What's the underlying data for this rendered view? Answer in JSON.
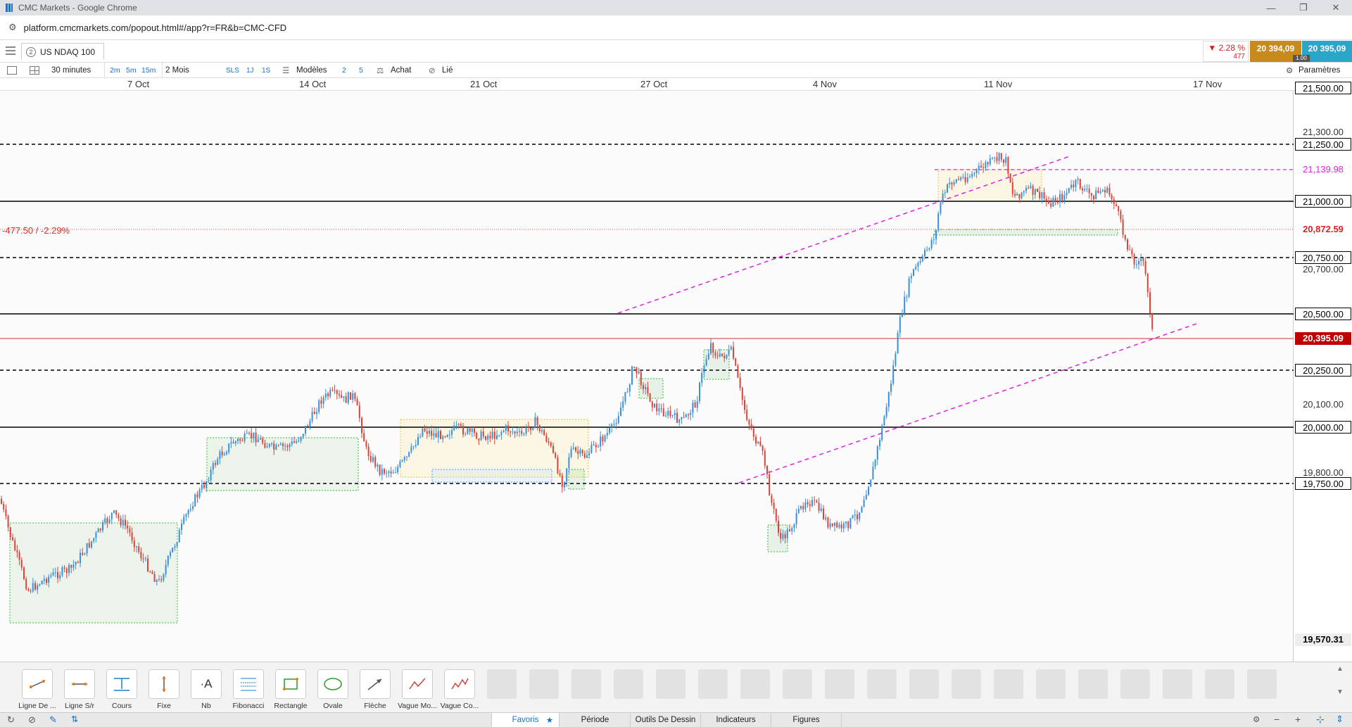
{
  "window": {
    "title": "CMC Markets - Google Chrome"
  },
  "browser": {
    "url": "platform.cmcmarkets.com/popout.html#/app?r=FR&b=CMC-CFD"
  },
  "instrument": {
    "badge": "2",
    "name": "US NDAQ 100"
  },
  "quote": {
    "change_pct": "▼ 2.28 %",
    "change_pts": "477",
    "sell": "20 394,09",
    "buy": "20 395,09",
    "spread": "1.00"
  },
  "toolbar": {
    "interval": "30 minutes",
    "quick_intervals": [
      "2m",
      "5m",
      "15m"
    ],
    "range": "2 Mois",
    "quick_ranges": [
      "SLS",
      "1J",
      "1S"
    ],
    "templates": "Modèles",
    "num_a": "2",
    "num_b": "5",
    "side": "Achat",
    "linked": "Lié",
    "settings": "Paramètres"
  },
  "date_axis": [
    "7 Oct",
    "14 Oct",
    "21 Oct",
    "27 Oct",
    "4 Nov",
    "11 Nov",
    "17 Nov"
  ],
  "price_axis": {
    "levels": [
      "21,500.00",
      "21,300.00",
      "21,250.00",
      "21,139.98",
      "21,000.00",
      "20,872.59",
      "20,750.00",
      "20,700.00",
      "20,500.00",
      "20,395.09",
      "20,250.00",
      "20,100.00",
      "20,000.00",
      "19,800.00",
      "19,750.00",
      "19,570.31"
    ]
  },
  "chart_annotation": "-477.50 / -2.29%",
  "drawing_tools": [
    "Ligne De ...",
    "Ligne S/r",
    "Cours",
    "Fixe",
    "Nb",
    "Fibonacci",
    "Rectangle",
    "Ovale",
    "Flèche",
    "Vague Mo...",
    "Vague Co..."
  ],
  "bottom_tabs": [
    "Favoris",
    "Période",
    "Outils De Dessin",
    "Indicateurs",
    "Figures"
  ],
  "colors": {
    "up": "#3a8fd8",
    "down": "#d9443a",
    "magenta": "#e020e0",
    "current_price": "#c00000"
  }
}
